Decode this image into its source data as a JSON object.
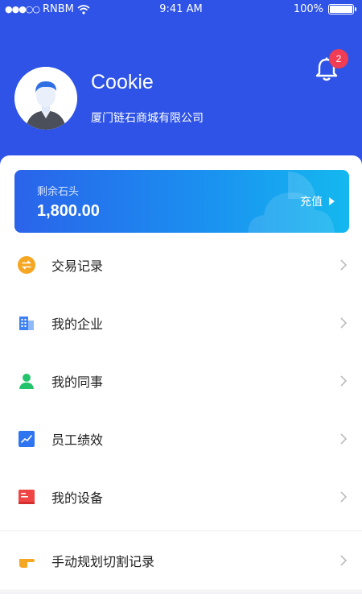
{
  "status_bar": {
    "carrier": "RNBM",
    "time": "9:41 AM",
    "battery": "100%"
  },
  "notification": {
    "count": "2"
  },
  "profile": {
    "name": "Cookie",
    "company": "厦门链石商城有限公司"
  },
  "balance": {
    "label": "剩余石头",
    "amount": "1,800.00",
    "action": "充值"
  },
  "menu": [
    {
      "label": "交易记录",
      "icon": "exchange-icon",
      "color": "#f5a623"
    },
    {
      "label": "我的企业",
      "icon": "building-icon",
      "color": "#3f82f3"
    },
    {
      "label": "我的同事",
      "icon": "person-icon",
      "color": "#23c46b"
    },
    {
      "label": "员工绩效",
      "icon": "chart-icon",
      "color": "#2f74f0"
    },
    {
      "label": "我的设备",
      "icon": "device-icon",
      "color": "#f04545"
    }
  ],
  "extra_item": {
    "label": "手动规划切割记录",
    "icon": "pointing-hand-icon",
    "color": "#f5a623"
  },
  "colors": {
    "header": "#2e53e6",
    "accent": "#1b8ff0"
  }
}
